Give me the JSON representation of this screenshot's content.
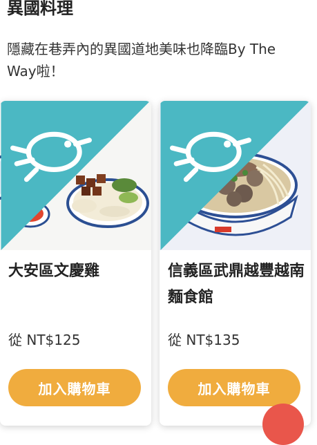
{
  "section": {
    "title": "異國料理",
    "description": "隱藏在巷弄內的異國道地美味也降臨By The Way啦！"
  },
  "products": [
    {
      "name": "大安區文慶雞",
      "price": "從 NT$125",
      "cart_label": "加入購物車"
    },
    {
      "name": "信義區武鼎越豐越南麵食館",
      "price": "從 NT$135",
      "cart_label": "加入購物車"
    }
  ],
  "colors": {
    "accent": "#f0ac3e",
    "ribbon": "#4bb8c3",
    "fab": "#e9564b"
  },
  "icons": [
    "bird-icon",
    "chat-fab"
  ]
}
